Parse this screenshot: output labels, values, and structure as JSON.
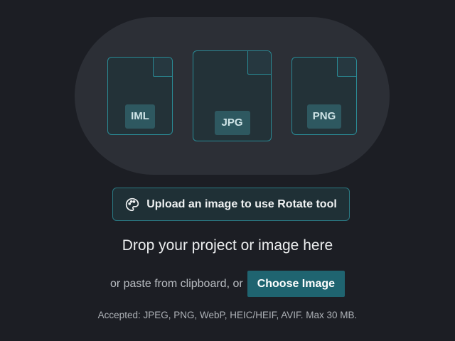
{
  "file_cards": [
    {
      "ext": "IML"
    },
    {
      "ext": "JPG"
    },
    {
      "ext": "PNG"
    }
  ],
  "upload_banner": {
    "icon": "palette-icon",
    "label": "Upload an image to use Rotate tool"
  },
  "drop_zone": {
    "title": "Drop your project or image here",
    "paste_text": "or paste from clipboard, or",
    "choose_button": "Choose Image",
    "accepted": "Accepted: JPEG, PNG, WebP, HEIC/HEIF, AVIF. Max 30 MB."
  },
  "colors": {
    "background": "#1c1e24",
    "hero": "#2c2f36",
    "accent": "#1f6470",
    "card_border": "#2a8a95"
  }
}
